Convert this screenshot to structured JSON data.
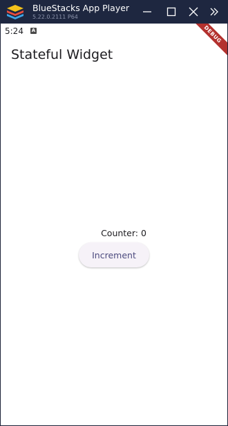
{
  "window": {
    "title": "BlueStacks App Player",
    "version": "5.22.0.2111 P64",
    "controls": [
      "minimize-icon",
      "maximize-icon",
      "close-icon",
      "expand-sidebar-icon"
    ]
  },
  "status_bar": {
    "time": "5:24",
    "icon": "keyboard-a-icon",
    "icon_letter": "A"
  },
  "debug_banner": {
    "label": "DEBUG",
    "color": "#b3312e"
  },
  "app_bar": {
    "title": "Stateful Widget"
  },
  "main": {
    "counter_text": "Counter: 0",
    "increment_label": "Increment"
  },
  "colors": {
    "titlebar": "#1e2740",
    "button_text": "#4c4a7e",
    "button_bg": "#f6f2f8"
  }
}
